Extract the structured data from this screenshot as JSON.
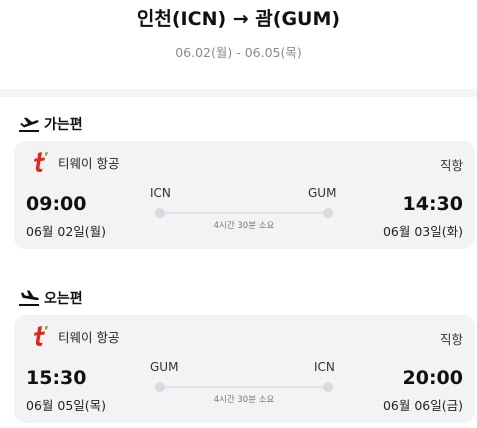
{
  "header": {
    "route": "인천(ICN) → 괌(GUM)",
    "dates": "06.02(월) - 06.05(목)"
  },
  "outbound": {
    "section_label": "가는편",
    "airline": "티웨이 항공",
    "type": "직항",
    "dep_time": "09:00",
    "dep_date": "06월 02일(월)",
    "dep_code": "ICN",
    "arr_time": "14:30",
    "arr_date": "06월 03일(화)",
    "arr_code": "GUM",
    "duration": "4시간 30분 소요"
  },
  "inbound": {
    "section_label": "오는편",
    "airline": "티웨이 항공",
    "type": "직항",
    "dep_time": "15:30",
    "dep_date": "06월 05일(목)",
    "dep_code": "GUM",
    "arr_time": "20:00",
    "arr_date": "06월 06일(금)",
    "arr_code": "ICN",
    "duration": "4시간 30분 소요"
  },
  "icons": {
    "departure": "plane-takeoff-icon",
    "arrival": "plane-landing-icon",
    "airline_logo": "tway-logo"
  },
  "colors": {
    "brand_red": "#e1261c",
    "brand_green": "#7ab51d",
    "card_bg": "#f3f3f5"
  }
}
